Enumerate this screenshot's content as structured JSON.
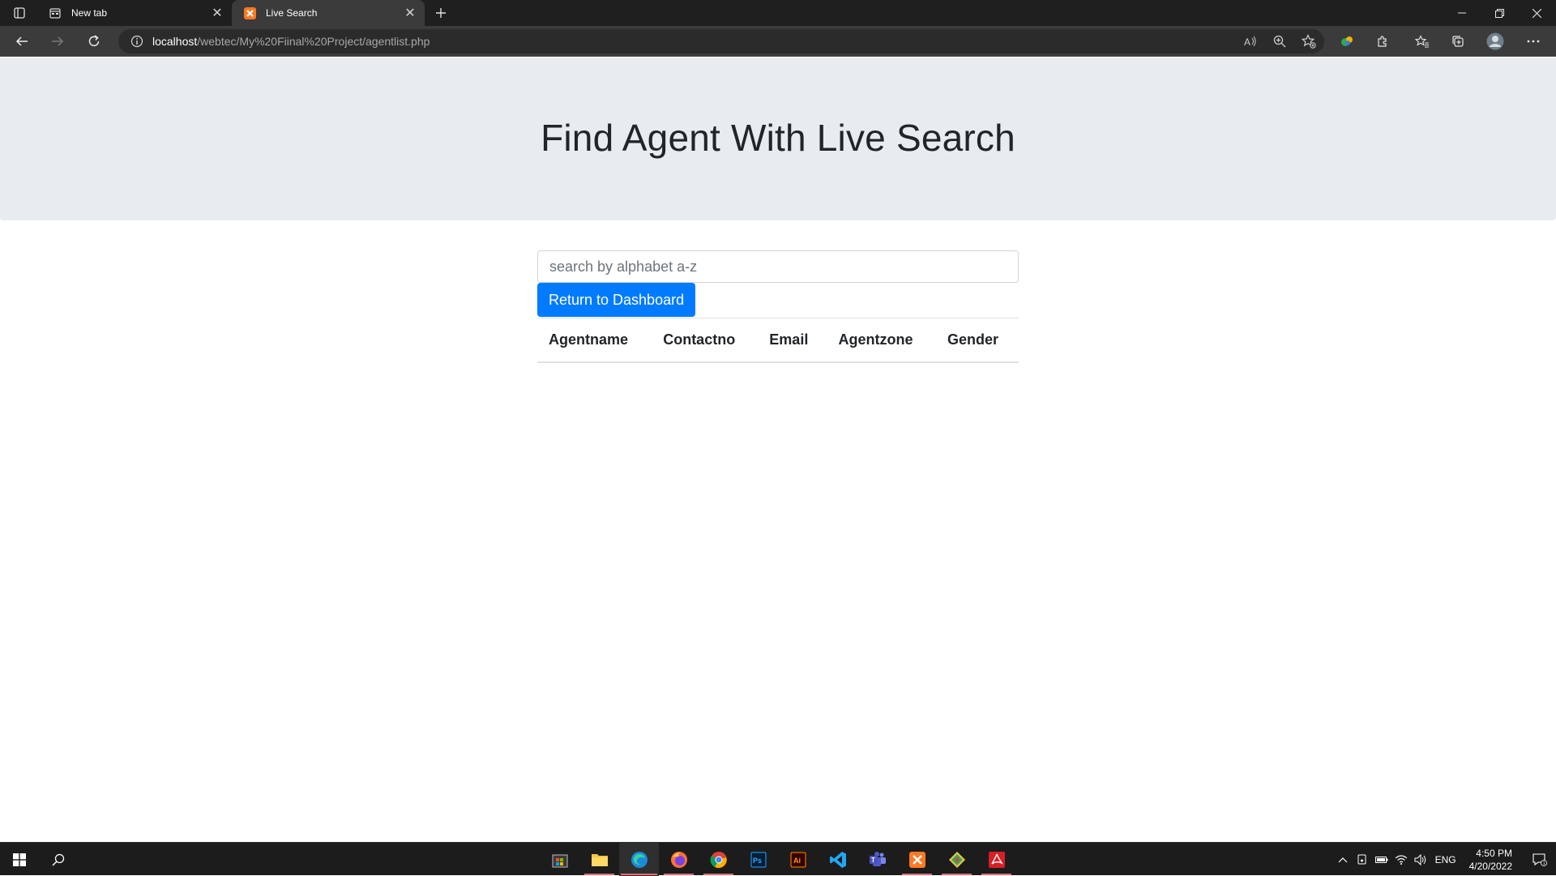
{
  "browser": {
    "tabs": [
      {
        "label": "New tab",
        "active": false
      },
      {
        "label": "Live Search",
        "active": true
      }
    ],
    "address": {
      "host": "localhost",
      "path": "/webtec/My%20Fiinal%20Project/agentlist.php"
    }
  },
  "page": {
    "heading": "Find Agent With Live Search",
    "search": {
      "placeholder": "search by alphabet a-z",
      "value": ""
    },
    "dashboard_button": "Return to Dashboard",
    "table": {
      "columns": [
        "Agentname",
        "Contactno",
        "Email",
        "Agentzone",
        "Gender"
      ],
      "rows": []
    }
  },
  "taskbar": {
    "apps": [
      "microsoft-store",
      "file-explorer",
      "edge",
      "firefox",
      "chrome",
      "photoshop",
      "illustrator",
      "vscode",
      "teams",
      "xampp",
      "git",
      "acrobat"
    ],
    "language": "ENG",
    "time": "4:50 PM",
    "date": "4/20/2022"
  },
  "colors": {
    "primary_button": "#007bff",
    "jumbotron_bg": "#e9ecef",
    "chrome_dark": "#1f1f1f",
    "toolbar_dark": "#3b3b3b"
  }
}
